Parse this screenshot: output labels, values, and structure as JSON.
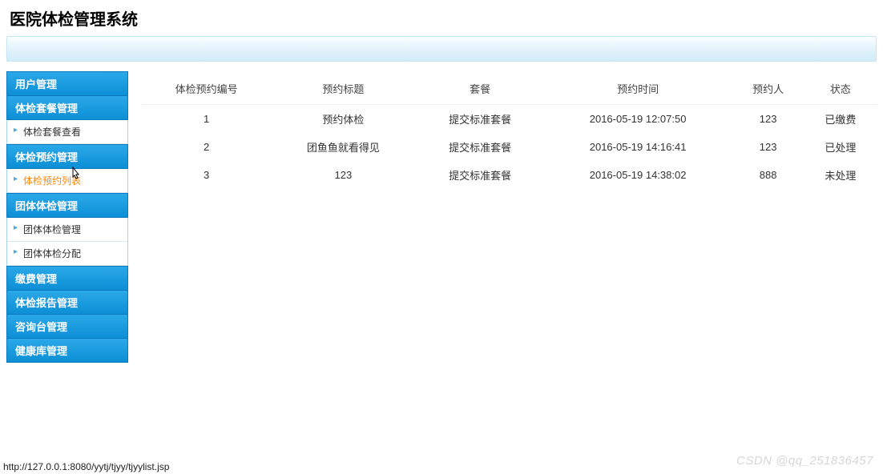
{
  "header": {
    "title": "医院体检管理系统"
  },
  "sidebar": {
    "groups": [
      {
        "label": "用户管理",
        "items": []
      },
      {
        "label": "体检套餐管理",
        "items": [
          {
            "label": "体检套餐查看",
            "active": false
          }
        ]
      },
      {
        "label": "体检预约管理",
        "items": [
          {
            "label": "体检预约列表",
            "active": true
          }
        ]
      },
      {
        "label": "团体体检管理",
        "items": [
          {
            "label": "团体体检管理",
            "active": false
          },
          {
            "label": "团体体检分配",
            "active": false
          }
        ]
      },
      {
        "label": "缴费管理",
        "items": []
      },
      {
        "label": "体检报告管理",
        "items": []
      },
      {
        "label": "咨询台管理",
        "items": []
      },
      {
        "label": "健康库管理",
        "items": []
      }
    ]
  },
  "table": {
    "headers": [
      "体检预约编号",
      "预约标题",
      "套餐",
      "预约时间",
      "预约人",
      "状态"
    ],
    "rows": [
      {
        "id": "1",
        "title": "预约体检",
        "package": "提交标准套餐",
        "time": "2016-05-19 12:07:50",
        "user": "123",
        "status": "已缴费"
      },
      {
        "id": "2",
        "title": "团鱼鱼就看得见",
        "package": "提交标准套餐",
        "time": "2016-05-19 14:16:41",
        "user": "123",
        "status": "已处理"
      },
      {
        "id": "3",
        "title": "123",
        "package": "提交标准套餐",
        "time": "2016-05-19 14:38:02",
        "user": "888",
        "status": "未处理"
      }
    ]
  },
  "statusbar": {
    "url": "http://127.0.0.1:8080/yytj/tjyy/tjyylist.jsp"
  },
  "watermark": {
    "text": "CSDN @qq_251836457"
  }
}
